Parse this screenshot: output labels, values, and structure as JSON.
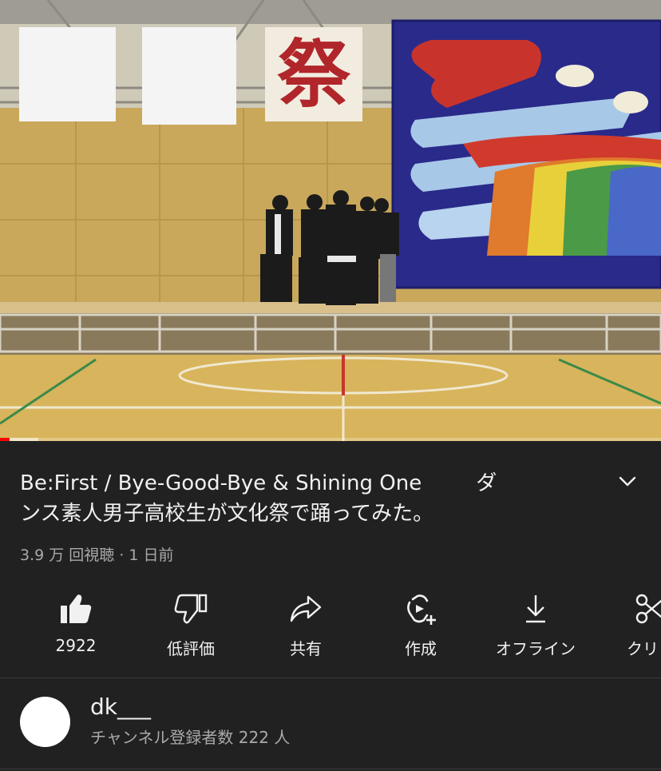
{
  "video": {
    "banner_text": "祭",
    "progress_played": 0.014,
    "progress_buffered": 0.058
  },
  "title": {
    "line1_part1": "Be:First / Bye-Good-Bye & Shining One",
    "line1_part2": "ダ",
    "line2": "ンス素人男子高校生が文化祭で踊ってみた。"
  },
  "meta": "3.9 万 回視聴 · 1 日前",
  "actions": [
    {
      "icon": "thumbs-up-filled-icon",
      "label": "2922"
    },
    {
      "icon": "thumbs-down-icon",
      "label": "低評価"
    },
    {
      "icon": "share-arrow-icon",
      "label": "共有"
    },
    {
      "icon": "create-icon",
      "label": "作成"
    },
    {
      "icon": "download-icon",
      "label": "オフライン"
    },
    {
      "icon": "scissors-icon",
      "label": "クリッ"
    }
  ],
  "channel": {
    "name": "dk___",
    "subscribers": "チャンネル登録者数 222 人"
  },
  "colors": {
    "background": "#212121",
    "text_primary": "#f1f1f1",
    "text_secondary": "#aaaaaa",
    "progress": "#ff0000"
  }
}
